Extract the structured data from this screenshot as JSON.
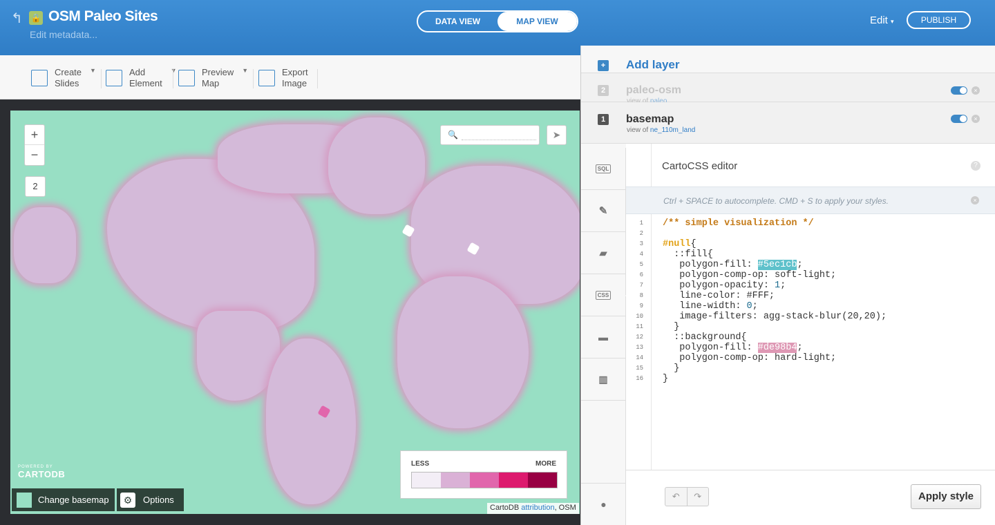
{
  "header": {
    "title": "OSM Paleo Sites",
    "edit_metadata": "Edit metadata...",
    "view_switch": {
      "data_view": "DATA VIEW",
      "map_view": "MAP VIEW",
      "active": "map_view"
    },
    "edit_menu": "Edit",
    "publish": "PUBLISH",
    "back_icon": "back-arrow-icon",
    "lock_icon": "lock-icon"
  },
  "toolbar": {
    "items": [
      {
        "label": "Create\nSlides",
        "icon": "slides-icon"
      },
      {
        "label": "Add\nElement",
        "icon": "element-icon"
      },
      {
        "label": "Preview\nMap",
        "icon": "preview-icon"
      },
      {
        "label": "Export\nImage",
        "icon": "image-icon"
      }
    ]
  },
  "map": {
    "zoom_in": "+",
    "zoom_out": "−",
    "slide_number": "2",
    "powered_by": "POWERED BY",
    "brand": "CARTODB",
    "change_basemap": "Change basemap",
    "options": "Options",
    "attribution_prefix": "CartoDB",
    "attribution_link": "attribution",
    "attribution_suffix": ", OSM",
    "legend": {
      "less": "LESS",
      "more": "MORE",
      "colors": [
        "#f3eef6",
        "#dab1d6",
        "#e166ac",
        "#dd1a6e",
        "#980043"
      ]
    },
    "land_color": "#d4bad9",
    "water_color": "#98dfc4"
  },
  "panel": {
    "add_layer": "Add layer",
    "layers": [
      {
        "index": "2",
        "name": "paleo-osm",
        "view_of_label": "view of",
        "table": "paleo",
        "enabled": true
      },
      {
        "index": "1",
        "name": "basemap",
        "view_of_label": "view of",
        "table": "ne_110m_land",
        "enabled": true
      }
    ],
    "tabs": [
      {
        "name": "sql",
        "label": "SQL"
      },
      {
        "name": "wizard",
        "label": ""
      },
      {
        "name": "infowindow",
        "label": ""
      },
      {
        "name": "css",
        "label": "CSS"
      },
      {
        "name": "legend",
        "label": ""
      },
      {
        "name": "filters",
        "label": ""
      },
      {
        "name": "tips",
        "label": ""
      }
    ],
    "editor": {
      "title": "CartoCSS editor",
      "hint": "Ctrl + SPACE to autocomplete. CMD + S to apply your styles.",
      "apply": "Apply style",
      "help": "?"
    },
    "code_lines": [
      "/** simple visualization */",
      "",
      "#null{",
      "  ::fill{",
      "   polygon-fill: #5ec1cb;",
      "   polygon-comp-op: soft-light;",
      "   polygon-opacity: 1;",
      "   line-color: #FFF;",
      "   line-width: 0;",
      "   image-filters: agg-stack-blur(20,20);",
      "  }",
      "  ::background{",
      "   polygon-fill: #de98b4;",
      "   polygon-comp-op: hard-light;",
      "  }",
      "}"
    ]
  }
}
